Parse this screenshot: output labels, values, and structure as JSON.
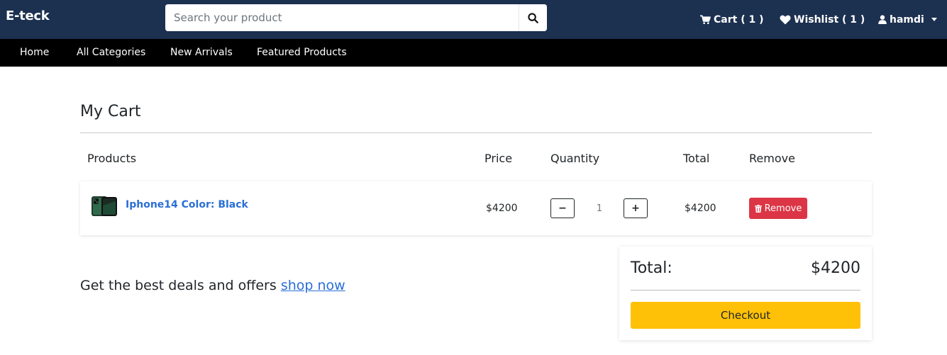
{
  "header": {
    "brand": "E-teck",
    "search_placeholder": "Search your product",
    "cart_label": "Cart ( 1 )",
    "wishlist_label": "Wishlist ( 1 )",
    "user_name": "hamdi"
  },
  "nav": {
    "items": [
      "Home",
      "All Categories",
      "New Arrivals",
      "Featured Products"
    ]
  },
  "cart": {
    "title": "My Cart",
    "columns": [
      "Products",
      "Price",
      "Quantity",
      "Total",
      "Remove"
    ],
    "items": [
      {
        "name": "Iphone14 Color: Black",
        "price": "$4200",
        "quantity": "1",
        "total": "$4200",
        "remove_label": "Remove"
      }
    ],
    "qty_minus": "−",
    "qty_plus": "+"
  },
  "promo": {
    "text": "Get the best deals and offers",
    "link": "shop now"
  },
  "summary": {
    "label": "Total:",
    "value": "$4200",
    "checkout_label": "Checkout"
  },
  "colors": {
    "header_bg": "#1c3050",
    "nav_bg": "#000000",
    "link": "#2a6fd6",
    "remove_btn": "#dc3545",
    "checkout_btn": "#ffc107"
  },
  "icons": [
    "search-icon",
    "cart-icon",
    "heart-icon",
    "user-icon",
    "trash-icon",
    "chevron-down-icon"
  ]
}
